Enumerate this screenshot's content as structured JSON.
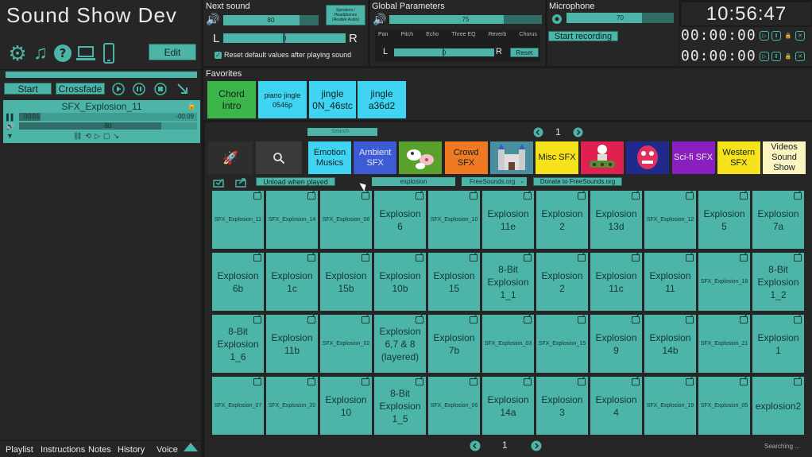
{
  "app": {
    "title": "Sound Show Dev",
    "edit_label": "Edit"
  },
  "player": {
    "start_label": "Start",
    "crossfade_label": "Crossfade",
    "track_name": "SFX_Explosion_11",
    "elapsed": "00:01",
    "remaining": "-00:09",
    "volume": "80",
    "progress": 0.12,
    "volume_fraction": 0.8
  },
  "next_sound": {
    "label": "Next sound",
    "volume": "80",
    "volume_fraction": 0.8,
    "device_label": "Speakers / Headphones (Realtek Audio)",
    "balance": "0",
    "balance_left": "L",
    "balance_right": "R",
    "reset_label": "Reset default values after playing sound"
  },
  "global": {
    "label": "Global Parameters",
    "volume": "75",
    "volume_fraction": 0.75,
    "tabs": [
      "Pan",
      "Pitch",
      "Echo",
      "Three EQ",
      "Reverb",
      "Chorus"
    ],
    "pan_value": "0",
    "pan_left": "L",
    "pan_right": "R",
    "reset_label": "Reset"
  },
  "microphone": {
    "label": "Microphone",
    "volume": "70",
    "volume_fraction": 0.7,
    "record_label": "Start recording"
  },
  "clock": {
    "time": "10:56:47",
    "timer1": "00:00:00",
    "timer2": "00:00:00"
  },
  "favorites": {
    "label": "Favorites",
    "items": [
      {
        "label": "Chord\nIntro",
        "color": "#3cb54a"
      },
      {
        "label": "piano jingle\n0546p",
        "color": "#3fd4f2"
      },
      {
        "label": "jingle\n0N_46stc",
        "color": "#3fd4f2"
      },
      {
        "label": "jingle\na36d2",
        "color": "#3fd4f2"
      }
    ]
  },
  "browser": {
    "search_placeholder": "Search",
    "page": "1",
    "unload_label": "Unload when played",
    "query": "explosion",
    "source": "FreeSounds.org",
    "donate_label": "Donate to FreeSounds.org",
    "bottom_page": "1",
    "status": "Searching ..."
  },
  "categories": [
    {
      "label": "Emotion\nMusics",
      "color": "#3fd4f2",
      "text": "#102020"
    },
    {
      "label": "Ambient\nSFX",
      "color": "#3e5bd6",
      "text": "#e8e8e8"
    },
    {
      "label": "",
      "color": "#5aa02c",
      "icon": "farm-animals-icon"
    },
    {
      "label": "Crowd\nSFX",
      "color": "#f07a24",
      "text": "#102020"
    },
    {
      "label": "",
      "color": "#4a8fa0",
      "icon": "castle-icon"
    },
    {
      "label": "Misc SFX",
      "color": "#f5e21b",
      "text": "#102020"
    },
    {
      "label": "",
      "color": "#e02050",
      "icon": "robot-tank-icon"
    },
    {
      "label": "",
      "color": "#1f2a8a",
      "icon": "monster-icon"
    },
    {
      "label": "Sci-fi SFX",
      "color": "#8a1fc0",
      "text": "#e8e8e8"
    },
    {
      "label": "Western\nSFX",
      "color": "#f5e21b",
      "text": "#102020"
    },
    {
      "label": "Videos\nSound\nShow",
      "color": "#fbf3c0",
      "text": "#102020"
    }
  ],
  "sounds": [
    [
      "SFX_Explosion_11",
      "SFX_Explosion_14",
      "SFX_Explosion_08",
      "Explosion\n6",
      "SFX_Explosion_10",
      "Explosion\n11e",
      "Explosion\n2",
      "Explosion\n13d",
      "SFX_Explosion_12",
      "Explosion\n5",
      "Explosion\n7a"
    ],
    [
      "Explosion\n6b",
      "Explosion\n1c",
      "Explosion\n15b",
      "Explosion\n10b",
      "Explosion\n15",
      "8-Bit\nExplosion\n1_1",
      "Explosion\n2",
      "Explosion\n11c",
      "Explosion\n11",
      "SFX_Explosion_18",
      "8-Bit\nExplosion\n1_2"
    ],
    [
      "8-Bit\nExplosion\n1_6",
      "Explosion\n11b",
      "SFX_Explosion_02",
      "Explosion\n6,7 & 8\n(layered)",
      "Explosion\n7b",
      "SFX_Explosion_03",
      "SFX_Explosion_15",
      "Explosion\n9",
      "Explosion\n14b",
      "SFX_Explosion_21",
      "Explosion\n1"
    ],
    [
      "SFX_Explosion_07",
      "SFX_Explosion_20",
      "Explosion\n10",
      "8-Bit\nExplosion\n1_5",
      "SFX_Explosion_06",
      "Explosion\n14a",
      "Explosion\n3",
      "Explosion\n4",
      "SFX_Explosion_19",
      "SFX_Explosion_05",
      "explosion2"
    ]
  ],
  "bottom_tabs": [
    "Playlist",
    "Instructions",
    "Notes",
    "History",
    "Voice"
  ],
  "colors": {
    "accent": "#4cb5a8",
    "background": "#1b1b1b",
    "panel": "#262626"
  }
}
